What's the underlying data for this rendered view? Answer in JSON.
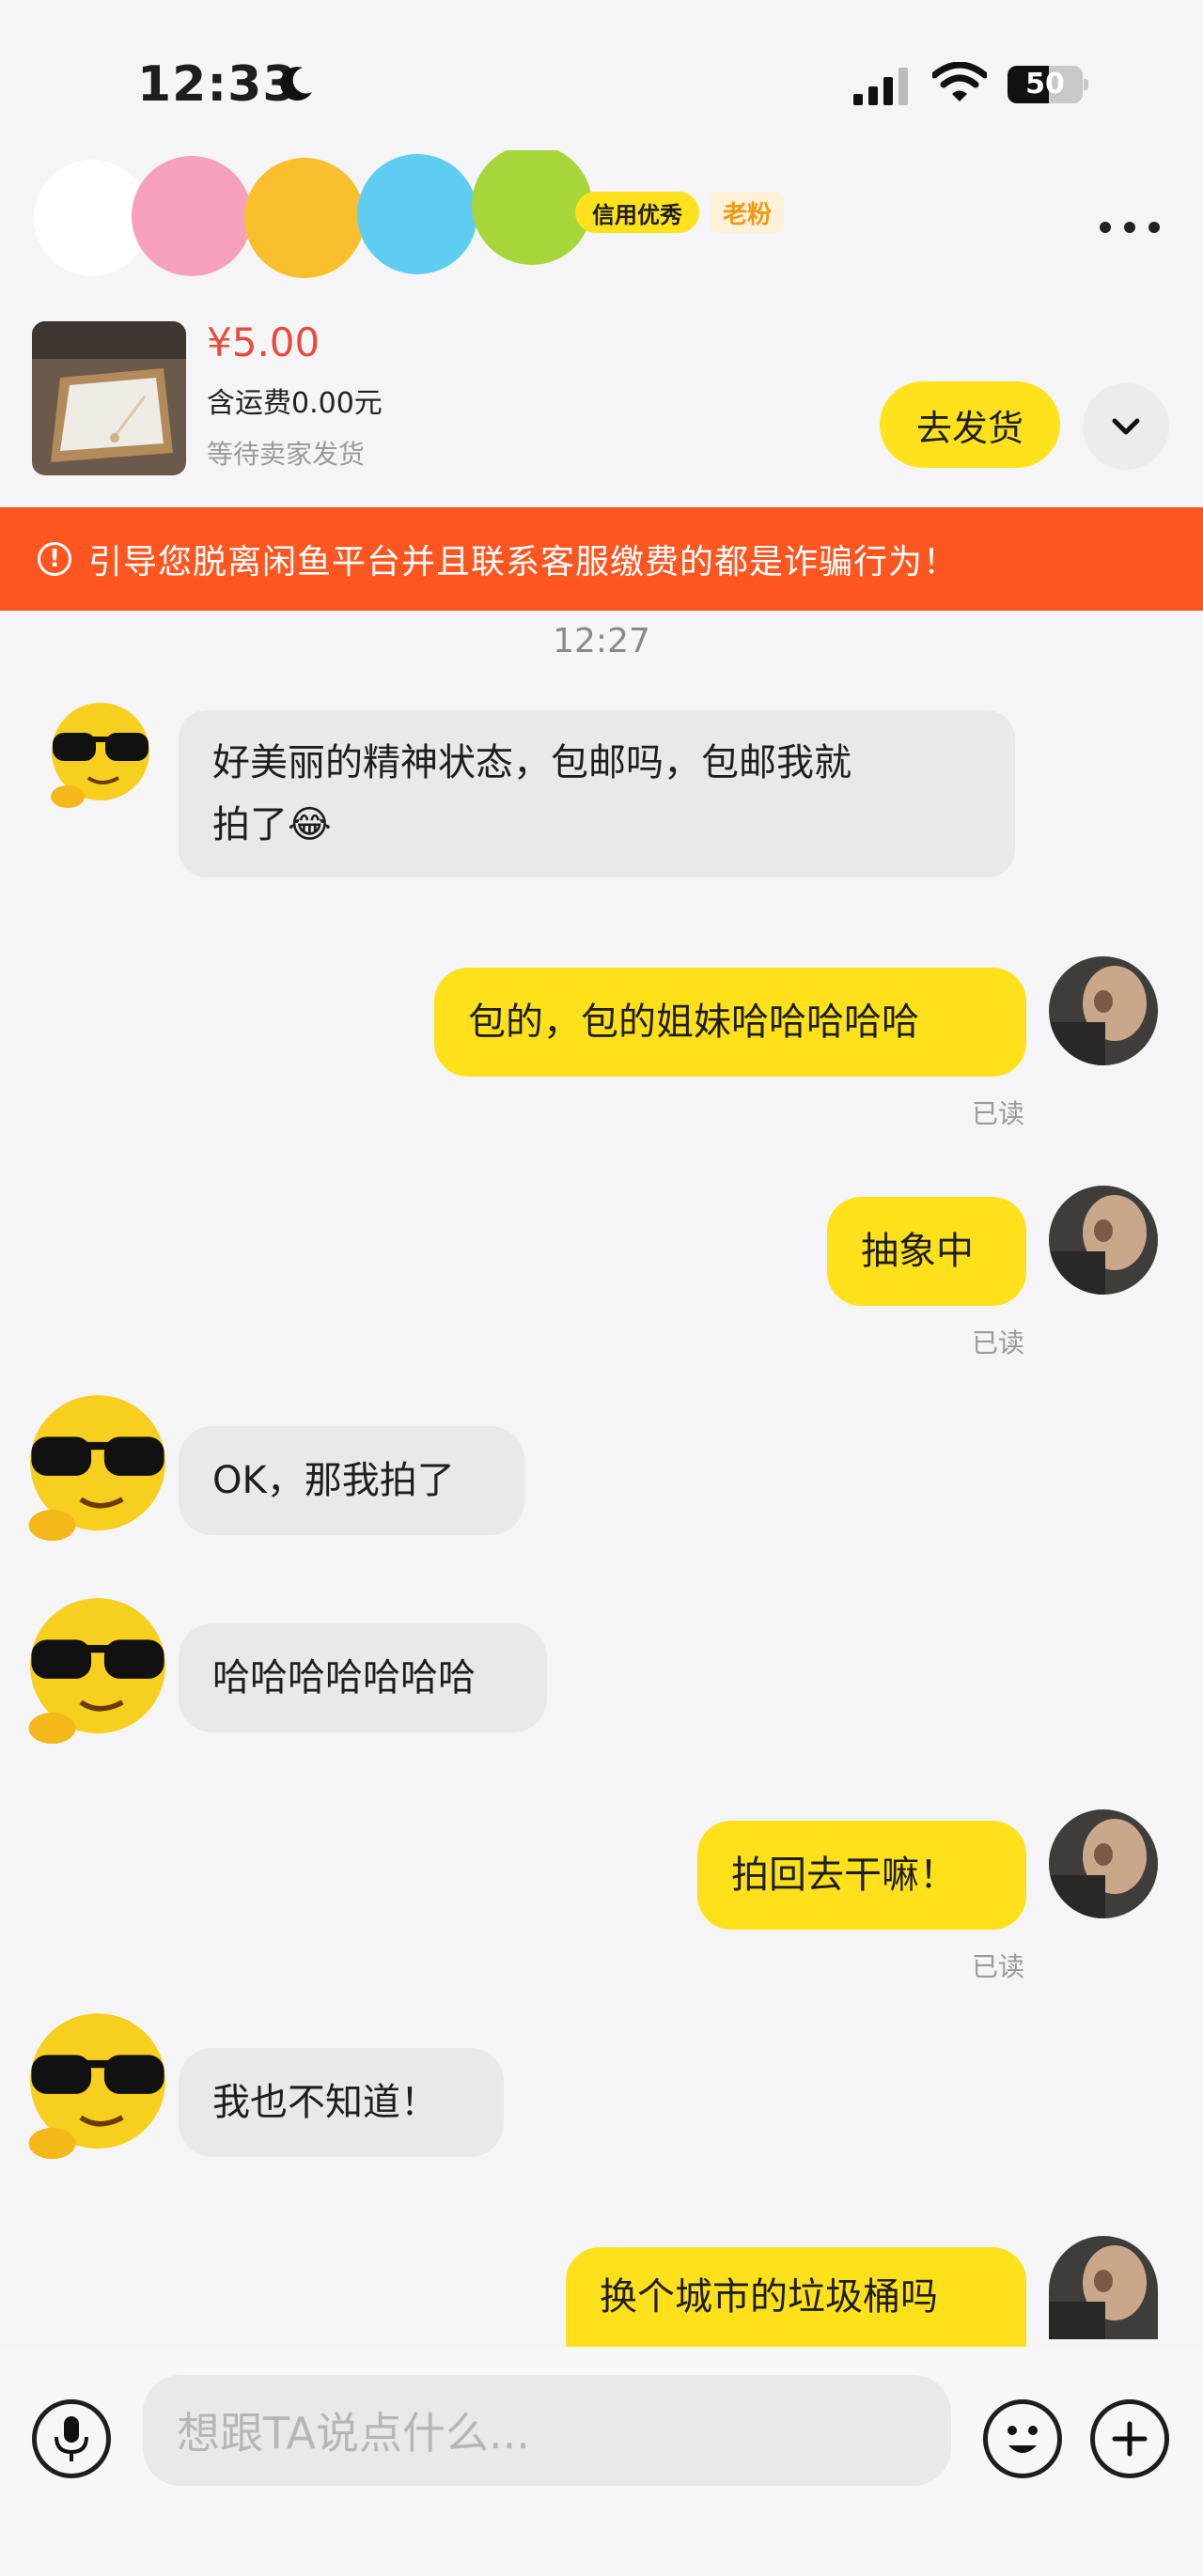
{
  "status_bar": {
    "time": "12:33",
    "battery": "50"
  },
  "header": {
    "credit_badge": "信用优秀",
    "fan_badge": "老粉"
  },
  "product": {
    "price": "¥5.00",
    "shipping": "含运费0.00元",
    "status": "等待卖家发货",
    "ship_button": "去发货"
  },
  "warning_banner": "引导您脱离闲鱼平台并且联系客服缴费的都是诈骗行为！",
  "chat": {
    "timestamp": "12:27",
    "messages": [
      {
        "side": "in",
        "line1": "好美丽的精神状态，包邮吗，包邮我就",
        "line2": "拍了😂"
      },
      {
        "side": "out",
        "text": "包的，包的姐妹哈哈哈哈哈",
        "read": "已读"
      },
      {
        "side": "out",
        "text": "抽象中",
        "read": "已读"
      },
      {
        "side": "in",
        "text": "OK，那我拍了"
      },
      {
        "side": "in",
        "text": "哈哈哈哈哈哈哈"
      },
      {
        "side": "out",
        "text": "拍回去干嘛！",
        "read": "已读"
      },
      {
        "side": "in",
        "text": "我也不知道！"
      },
      {
        "side": "out",
        "text": "换个城市的垃圾桶吗"
      }
    ]
  },
  "input_bar": {
    "placeholder": "想跟TA说点什么..."
  },
  "icons": [
    "moon-icon",
    "signal-icon",
    "wifi-icon",
    "battery-icon",
    "more-icon",
    "chevron-down-icon",
    "warning-icon",
    "microphone-icon",
    "emoji-icon",
    "plus-icon"
  ],
  "colors": {
    "accent_yellow": "#ffe11b",
    "warning_orange": "#fe5621",
    "price_red": "#e94a3c",
    "background": "#f5f5f7"
  }
}
